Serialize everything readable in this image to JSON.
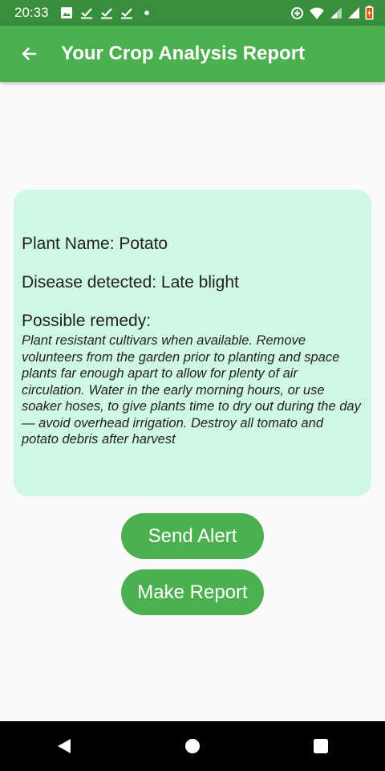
{
  "status_bar": {
    "time": "20:33",
    "icons": [
      "image-icon",
      "download-done-icon",
      "download-done-icon",
      "download-done-icon",
      "dot-icon",
      "data-saver-icon",
      "wifi-icon",
      "signal-icon",
      "signal-icon",
      "battery-charging-icon"
    ]
  },
  "app_bar": {
    "title": "Your Crop Analysis Report",
    "back_icon": "arrow-back-icon"
  },
  "report": {
    "plant_name": "Plant Name: Potato",
    "disease": "Disease detected: Late blight",
    "remedy_label": "Possible remedy:",
    "remedy_text": "Plant resistant cultivars when available. Remove volunteers from the garden prior to planting and space plants far enough apart to allow for plenty of air circulation. Water in the early morning hours, or use soaker hoses, to give plants time to dry out during the day — avoid overhead irrigation. Destroy all tomato and potato debris after harvest"
  },
  "buttons": {
    "send_alert": "Send Alert",
    "make_report": "Make Report"
  },
  "colors": {
    "primary": "#4caf50",
    "primary_dark": "#388e3c",
    "card_bg": "#cff7e4",
    "background": "#fafafa"
  }
}
